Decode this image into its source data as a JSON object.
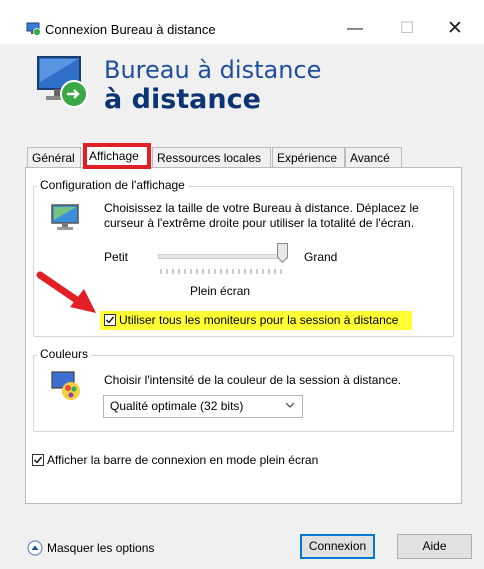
{
  "window": {
    "title": "Connexion Bureau à distance",
    "minimize_glyph": "—",
    "maximize_glyph": "☐",
    "close_glyph": "✕"
  },
  "header": {
    "line1": "Bureau à distance",
    "line2": "à distance"
  },
  "tabs": [
    {
      "label": "Général"
    },
    {
      "label": "Affichage"
    },
    {
      "label": "Ressources locales"
    },
    {
      "label": "Expérience"
    },
    {
      "label": "Avancé"
    }
  ],
  "display_group": {
    "legend": "Configuration de l'affichage",
    "description": "Choisissez la taille de votre Bureau à distance. Déplacez le curseur à l'extrême droite pour utiliser la totalité de l'écran.",
    "slider_min_label": "Petit",
    "slider_max_label": "Grand",
    "slider_value": 1.0,
    "slider_value_label": "Plein écran",
    "use_all_monitors_label": "Utiliser tous les moniteurs pour la session à distance",
    "use_all_monitors_checked": true
  },
  "colors_group": {
    "legend": "Couleurs",
    "prompt": "Choisir l'intensité de la couleur de la session à distance.",
    "selected_quality": "Qualité optimale (32 bits)"
  },
  "connection_bar": {
    "label": "Afficher la barre de connexion en mode plein écran",
    "checked": true
  },
  "footer": {
    "hide_options_label": "Masquer les options",
    "connect_button": "Connexion",
    "help_button": "Aide"
  },
  "icons": {
    "app": "remote-desktop-icon",
    "header_logo": "remote-desktop-logo-icon",
    "display": "monitor-icon",
    "colors": "palette-icon",
    "hide": "chevron-up-circle-icon",
    "annotation": "red-arrow-icon"
  },
  "colors": {
    "highlight": "#ffff33",
    "annotation": "#e31e24",
    "header_text": "#1f4f9c"
  }
}
